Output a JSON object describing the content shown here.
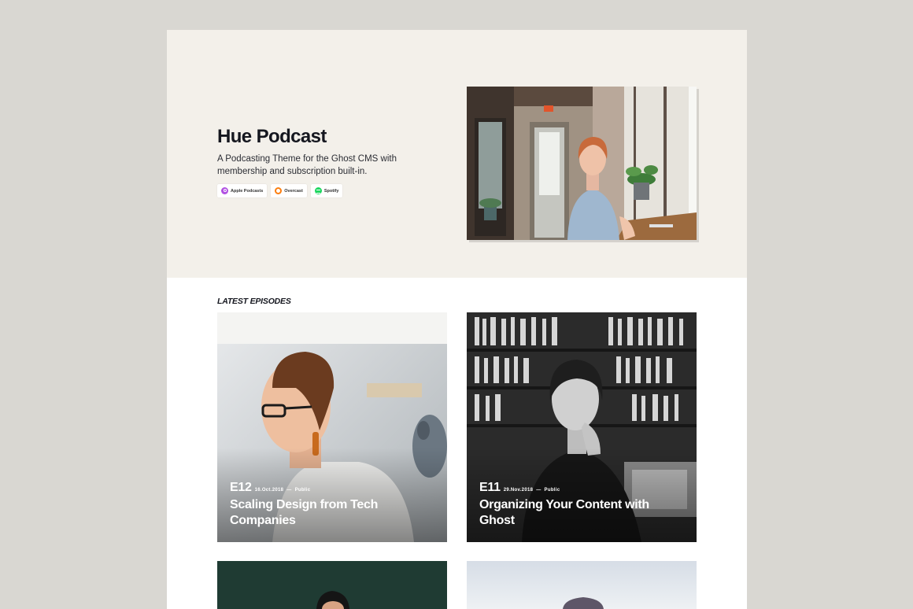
{
  "site": {
    "title": "Hue Podcast",
    "description": "A Podcasting Theme for the Ghost CMS with membership and subscription built-in.",
    "platforms": [
      {
        "label": "Apple Podcasts",
        "icon": "apple-podcasts-icon",
        "color": "#b150e2"
      },
      {
        "label": "Overcast",
        "icon": "overcast-icon",
        "color": "#fc7e0f"
      },
      {
        "label": "Spotify",
        "icon": "spotify-icon",
        "color": "#1ed760"
      }
    ]
  },
  "latest": {
    "heading": "LATEST EPISODES",
    "episodes": [
      {
        "number": "E12",
        "date": "16.Oct.2018",
        "separator": "—",
        "access": "Public",
        "title": "Scaling Design from Tech Companies"
      },
      {
        "number": "E11",
        "date": "29.Nov.2018",
        "separator": "—",
        "access": "Public",
        "title": "Organizing Your Content with Ghost"
      }
    ]
  },
  "colors": {
    "background": "#d9d7d2",
    "hero_background": "#f3f0ea",
    "text": "#15171f"
  }
}
